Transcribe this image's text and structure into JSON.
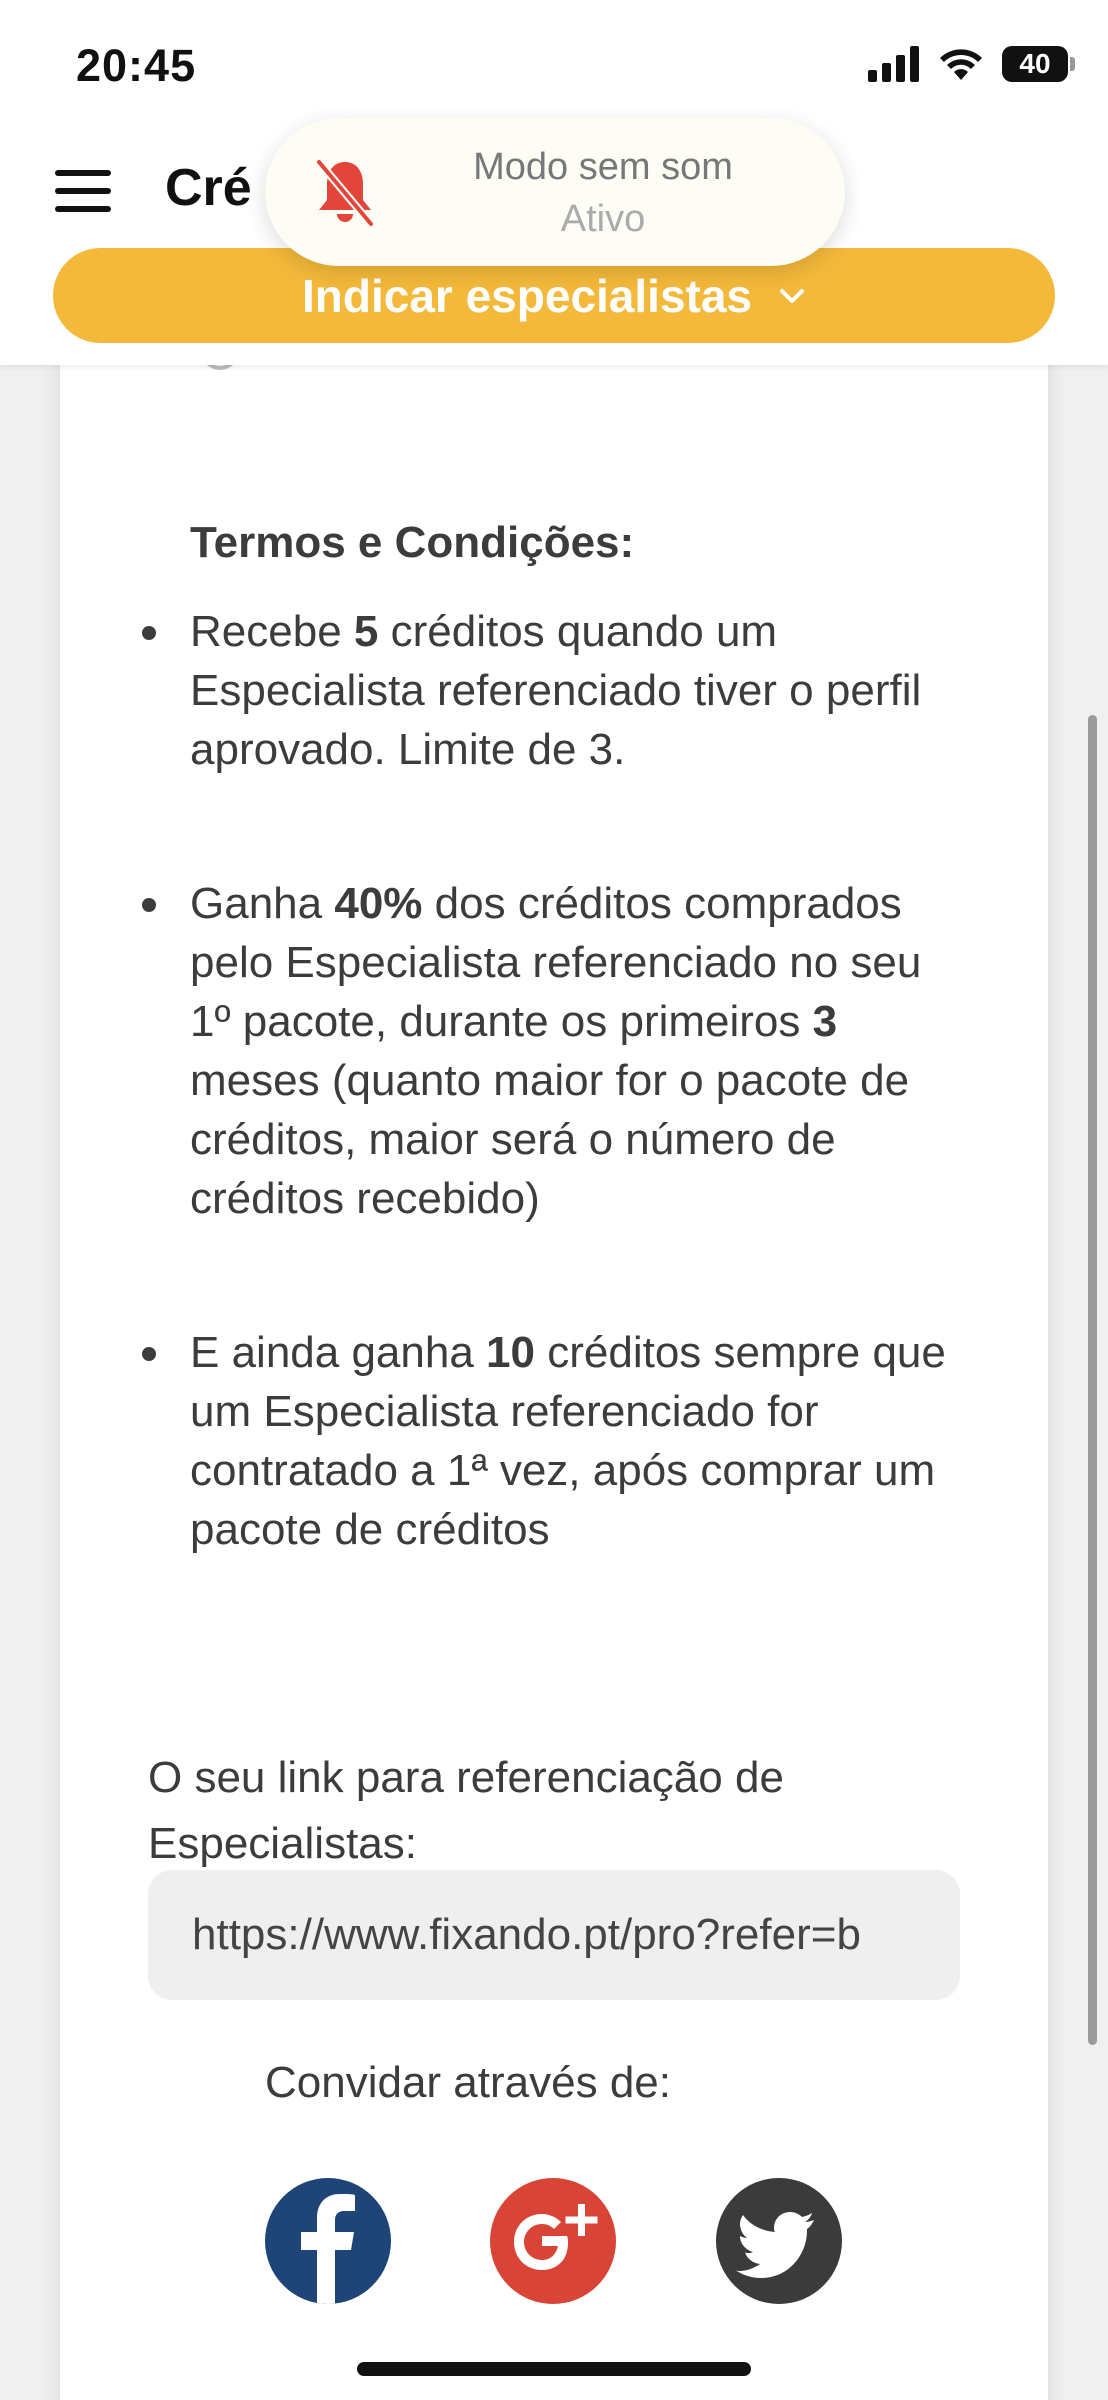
{
  "status_bar": {
    "time": "20:45",
    "battery_level": "40",
    "icons": [
      "signal-bars-icon",
      "wifi-icon",
      "battery-icon"
    ]
  },
  "header": {
    "title": "Cré",
    "menu_icon": "hamburger-menu-icon",
    "refer_button_label": "Indicar especialistas",
    "refer_button_icon": "chevron-down-icon",
    "accent_color": "#f4b93a"
  },
  "toast": {
    "icon": "bell-muted-icon",
    "title": "Modo sem som",
    "subtitle": "Ativo",
    "icon_color": "#e2463b"
  },
  "terms": {
    "title": "Termos e Condições:",
    "items": [
      {
        "p1": "Recebe ",
        "b1": "5",
        "p2": " créditos quando um Especialista referenciado tiver o perfil aprovado. Limite de 3.",
        "b2": "",
        "p3": ""
      },
      {
        "p1": "Ganha ",
        "b1": "40%",
        "p2": " dos créditos comprados pelo Especialista referenciado no seu 1º pacote, durante os primeiros ",
        "b2": "3",
        "p3": " meses (quanto maior for o pacote de créditos, maior será o número de créditos recebido)"
      },
      {
        "p1": "E ainda ganha ",
        "b1": "10",
        "p2": " créditos sempre que um Especialista referenciado for contratado a 1ª vez, após comprar um pacote de créditos",
        "b2": "",
        "p3": ""
      }
    ]
  },
  "referral": {
    "link_label": "O seu link para referenciação de Especialistas:",
    "link_value": "https://www.fixando.pt/pro?refer=b"
  },
  "invite": {
    "label": "Convidar através de:",
    "networks": [
      {
        "icon": "facebook-icon",
        "color": "#1e4478"
      },
      {
        "icon": "google-plus-icon",
        "color": "#d84436"
      },
      {
        "icon": "twitter-icon",
        "color": "#3b3b3b"
      }
    ]
  }
}
